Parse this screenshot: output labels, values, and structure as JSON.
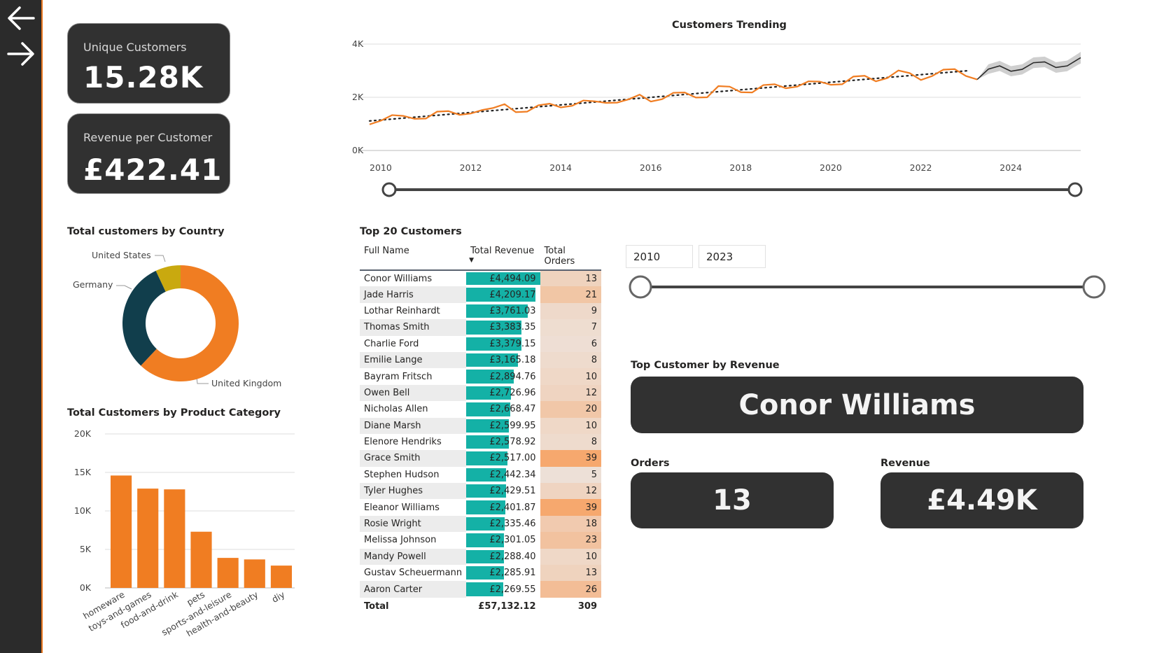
{
  "nav": {
    "back_icon": "arrow-left-icon",
    "forward_icon": "arrow-right-icon"
  },
  "kpis": {
    "unique_customers": {
      "label": "Unique Customers",
      "value": "15.28K"
    },
    "revenue_per_customer": {
      "label": "Revenue per Customer",
      "value": "£422.41"
    }
  },
  "trend": {
    "title": "Customers Trending",
    "y_ticks": [
      "4K",
      "2K",
      "0K"
    ],
    "x_ticks": [
      "2010",
      "2012",
      "2014",
      "2016",
      "2018",
      "2020",
      "2022",
      "2024"
    ]
  },
  "country": {
    "title": "Total customers by Country",
    "labels": [
      "United States",
      "Germany",
      "United Kingdom"
    ]
  },
  "category": {
    "title": "Total Customers by Product Category",
    "y_ticks": [
      "20K",
      "15K",
      "10K",
      "5K",
      "0K"
    ]
  },
  "top20": {
    "title": "Top 20 Customers",
    "headers": {
      "name": "Full Name",
      "revenue": "Total Revenue",
      "orders": "Total Orders"
    },
    "rows": [
      {
        "name": "Conor Williams",
        "revenue": "£4,494.09",
        "orders": "13"
      },
      {
        "name": "Jade Harris",
        "revenue": "£4,209.17",
        "orders": "21"
      },
      {
        "name": "Lothar Reinhardt",
        "revenue": "£3,761.03",
        "orders": "9"
      },
      {
        "name": "Thomas Smith",
        "revenue": "£3,383.35",
        "orders": "7"
      },
      {
        "name": "Charlie Ford",
        "revenue": "£3,379.15",
        "orders": "6"
      },
      {
        "name": "Emilie Lange",
        "revenue": "£3,165.18",
        "orders": "8"
      },
      {
        "name": "Bayram Fritsch",
        "revenue": "£2,894.76",
        "orders": "10"
      },
      {
        "name": "Owen Bell",
        "revenue": "£2,726.96",
        "orders": "12"
      },
      {
        "name": "Nicholas Allen",
        "revenue": "£2,668.47",
        "orders": "20"
      },
      {
        "name": "Diane Marsh",
        "revenue": "£2,599.95",
        "orders": "10"
      },
      {
        "name": "Elenore Hendriks",
        "revenue": "£2,578.92",
        "orders": "8"
      },
      {
        "name": "Grace Smith",
        "revenue": "£2,517.00",
        "orders": "39"
      },
      {
        "name": "Stephen Hudson",
        "revenue": "£2,442.34",
        "orders": "5"
      },
      {
        "name": "Tyler Hughes",
        "revenue": "£2,429.51",
        "orders": "12"
      },
      {
        "name": "Eleanor Williams",
        "revenue": "£2,401.87",
        "orders": "39"
      },
      {
        "name": "Rosie Wright",
        "revenue": "£2,335.46",
        "orders": "18"
      },
      {
        "name": "Melissa Johnson",
        "revenue": "£2,301.05",
        "orders": "23"
      },
      {
        "name": "Mandy Powell",
        "revenue": "£2,288.40",
        "orders": "10"
      },
      {
        "name": "Gustav Scheuermann",
        "revenue": "£2,285.91",
        "orders": "13"
      },
      {
        "name": "Aaron Carter",
        "revenue": "£2,269.55",
        "orders": "26"
      }
    ],
    "total": {
      "label": "Total",
      "revenue": "£57,132.12",
      "orders": "309"
    }
  },
  "year_slicer": {
    "from": "2010",
    "to": "2023"
  },
  "top_customer": {
    "title": "Top Customer by Revenue",
    "name": "Conor Williams",
    "orders_label": "Orders",
    "orders": "13",
    "revenue_label": "Revenue",
    "revenue": "£4.49K"
  },
  "colors": {
    "orange": "#f07d22",
    "teal": "#14b1a6",
    "navy": "#113e4c",
    "mustard": "#c9a90f",
    "card": "#313131"
  },
  "chart_data": [
    {
      "type": "line",
      "title": "Customers Trending",
      "x_range": [
        2010,
        2025.8
      ],
      "ylim": [
        0,
        4000
      ],
      "series": [
        {
          "values": [
            {
              "x": 2010.0,
              "y": 980
            },
            {
              "x": 2010.25,
              "y": 1120
            },
            {
              "x": 2010.5,
              "y": 1330
            },
            {
              "x": 2010.75,
              "y": 1300
            },
            {
              "x": 2011.0,
              "y": 1190
            },
            {
              "x": 2011.25,
              "y": 1200
            },
            {
              "x": 2011.5,
              "y": 1460
            },
            {
              "x": 2011.75,
              "y": 1480
            },
            {
              "x": 2012.0,
              "y": 1340
            },
            {
              "x": 2012.25,
              "y": 1390
            },
            {
              "x": 2012.5,
              "y": 1520
            },
            {
              "x": 2012.75,
              "y": 1600
            },
            {
              "x": 2013.0,
              "y": 1740
            },
            {
              "x": 2013.25,
              "y": 1440
            },
            {
              "x": 2013.5,
              "y": 1460
            },
            {
              "x": 2013.75,
              "y": 1700
            },
            {
              "x": 2014.0,
              "y": 1760
            },
            {
              "x": 2014.25,
              "y": 1620
            },
            {
              "x": 2014.5,
              "y": 1680
            },
            {
              "x": 2014.75,
              "y": 1880
            },
            {
              "x": 2015.0,
              "y": 1850
            },
            {
              "x": 2015.25,
              "y": 1790
            },
            {
              "x": 2015.5,
              "y": 1800
            },
            {
              "x": 2015.75,
              "y": 1920
            },
            {
              "x": 2016.0,
              "y": 2100
            },
            {
              "x": 2016.25,
              "y": 1840
            },
            {
              "x": 2016.5,
              "y": 1930
            },
            {
              "x": 2016.75,
              "y": 2170
            },
            {
              "x": 2017.0,
              "y": 2180
            },
            {
              "x": 2017.25,
              "y": 1990
            },
            {
              "x": 2017.5,
              "y": 2000
            },
            {
              "x": 2017.75,
              "y": 2420
            },
            {
              "x": 2018.0,
              "y": 2400
            },
            {
              "x": 2018.25,
              "y": 2190
            },
            {
              "x": 2018.5,
              "y": 2180
            },
            {
              "x": 2018.75,
              "y": 2460
            },
            {
              "x": 2019.0,
              "y": 2490
            },
            {
              "x": 2019.25,
              "y": 2340
            },
            {
              "x": 2019.5,
              "y": 2400
            },
            {
              "x": 2019.75,
              "y": 2600
            },
            {
              "x": 2020.0,
              "y": 2590
            },
            {
              "x": 2020.25,
              "y": 2470
            },
            {
              "x": 2020.5,
              "y": 2490
            },
            {
              "x": 2020.75,
              "y": 2780
            },
            {
              "x": 2021.0,
              "y": 2810
            },
            {
              "x": 2021.25,
              "y": 2600
            },
            {
              "x": 2021.5,
              "y": 2720
            },
            {
              "x": 2021.75,
              "y": 3010
            },
            {
              "x": 2022.0,
              "y": 2910
            },
            {
              "x": 2022.25,
              "y": 2650
            },
            {
              "x": 2022.5,
              "y": 2800
            },
            {
              "x": 2022.75,
              "y": 3040
            },
            {
              "x": 2023.0,
              "y": 3060
            },
            {
              "x": 2023.25,
              "y": 2800
            },
            {
              "x": 2023.5,
              "y": 2670
            }
          ]
        },
        {
          "values": [
            {
              "x": 2023.5,
              "y": 2670
            },
            {
              "x": 2023.75,
              "y": 3060
            },
            {
              "x": 2024.0,
              "y": 3180
            },
            {
              "x": 2024.25,
              "y": 2980
            },
            {
              "x": 2024.5,
              "y": 3050
            },
            {
              "x": 2024.75,
              "y": 3300
            },
            {
              "x": 2025.0,
              "y": 3330
            },
            {
              "x": 2025.25,
              "y": 3120
            },
            {
              "x": 2025.5,
              "y": 3180
            },
            {
              "x": 2025.75,
              "y": 3440
            },
            {
              "x": 2025.8,
              "y": 3490
            }
          ]
        }
      ],
      "trendline": [
        {
          "x": 2010.0,
          "y": 1110
        },
        {
          "x": 2023.3,
          "y": 3000
        }
      ],
      "forecast_band": [
        {
          "x": 2023.5,
          "lo": 2670,
          "hi": 2670
        },
        {
          "x": 2023.75,
          "lo": 2880,
          "hi": 3240
        },
        {
          "x": 2024.0,
          "lo": 2990,
          "hi": 3370
        },
        {
          "x": 2024.25,
          "lo": 2790,
          "hi": 3170
        },
        {
          "x": 2024.5,
          "lo": 2860,
          "hi": 3240
        },
        {
          "x": 2024.75,
          "lo": 3100,
          "hi": 3500
        },
        {
          "x": 2025.0,
          "lo": 3130,
          "hi": 3530
        },
        {
          "x": 2025.25,
          "lo": 2920,
          "hi": 3320
        },
        {
          "x": 2025.5,
          "lo": 2980,
          "hi": 3380
        },
        {
          "x": 2025.75,
          "lo": 3230,
          "hi": 3650
        },
        {
          "x": 2025.8,
          "lo": 3270,
          "hi": 3710
        }
      ]
    },
    {
      "type": "pie",
      "title": "Total customers by Country",
      "labels": [
        "United Kingdom",
        "Germany",
        "United States"
      ],
      "values": [
        62,
        31,
        7
      ],
      "colors": [
        "#f07d22",
        "#113e4c",
        "#c9a90f"
      ]
    },
    {
      "type": "bar",
      "title": "Total Customers by Product Category",
      "categories": [
        "homeware",
        "toys-and-games",
        "food-and-drink",
        "pets",
        "sports-and-leisure",
        "health-and-beauty",
        "diy"
      ],
      "values": [
        14600,
        12900,
        12800,
        7300,
        3900,
        3700,
        2900
      ],
      "ylim": [
        0,
        20000
      ]
    },
    {
      "type": "table",
      "title": "Top 20 Customers",
      "bar_values": [
        4494.09,
        4209.17,
        3761.03,
        3383.35,
        3379.15,
        3165.18,
        2894.76,
        2726.96,
        2668.47,
        2599.95,
        2578.92,
        2517.0,
        2442.34,
        2429.51,
        2401.87,
        2335.46,
        2301.05,
        2288.4,
        2285.91,
        2269.55
      ],
      "order_values": [
        13,
        21,
        9,
        7,
        6,
        8,
        10,
        12,
        20,
        10,
        8,
        39,
        5,
        12,
        39,
        18,
        23,
        10,
        13,
        26
      ]
    }
  ]
}
